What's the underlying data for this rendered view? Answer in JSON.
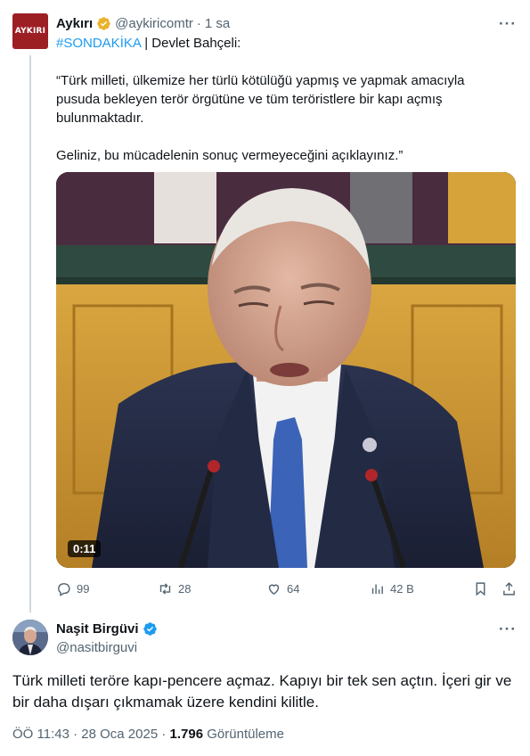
{
  "tweet1": {
    "author_name": "Aykırı",
    "avatar_text": "AYKIRI",
    "handle": "@aykiricomtr",
    "separator": "·",
    "time": "1 sa",
    "more": "···",
    "hashtag": "#SONDAKİKA",
    "headline_rest": "| Devlet Bahçeli:",
    "quote_p1": "“Türk milleti, ülkemize her türlü kötülüğü yapmış ve yapmak amacıyla pusuda bekleyen terör örgütüne ve tüm teröristlere bir kapı açmış bulunmaktadır.",
    "quote_p2": "Geliniz, bu mücadelenin sonuç vermeyeceğini açıklayınız.”",
    "video_time": "0:11",
    "replies": "99",
    "retweets": "28",
    "likes": "64",
    "views": "42 B"
  },
  "tweet2": {
    "author_name": "Naşit Birgüvi",
    "handle": "@nasitbirguvi",
    "more": "···",
    "body": "Türk milleti teröre kapı-pencere açmaz. Kapıyı bir tek sen açtın. İçeri gir ve bir daha dışarı çıkmamak üzere kendini kilitle.",
    "time": "ÖÖ 11:43",
    "date": "28 Oca 2025",
    "dot": "·",
    "view_count": "1.796",
    "view_label": "Görüntüleme"
  },
  "colors": {
    "accent": "#1d9bf0",
    "verified_badge": "#e8b32a",
    "muted": "#536471",
    "thread_line": "#cfd9de"
  },
  "icons": [
    "verified-icon",
    "more-icon",
    "reply-icon",
    "retweet-icon",
    "like-icon",
    "views-icon",
    "bookmark-icon",
    "share-icon"
  ]
}
